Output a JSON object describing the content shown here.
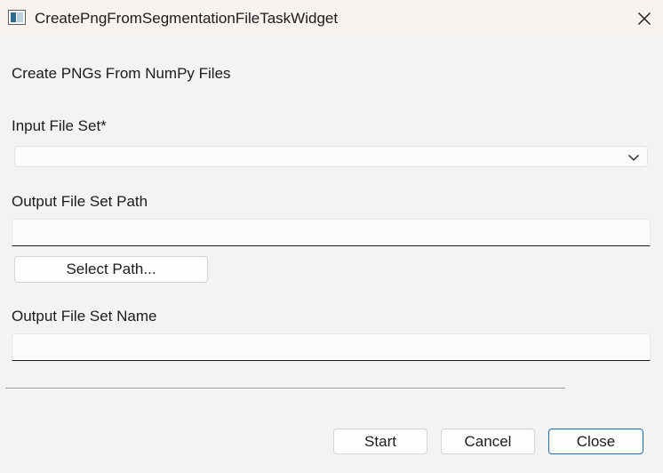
{
  "window": {
    "title": "CreatePngFromSegmentationFileTaskWidget",
    "icon": "app-window-icon",
    "close_icon": "close-icon"
  },
  "form": {
    "heading": "Create PNGs From NumPy Files",
    "input_file_set": {
      "label": "Input File Set*",
      "selected_value": "",
      "dropdown_icon": "chevron-down-icon"
    },
    "output_path": {
      "label": "Output File Set Path",
      "value": "",
      "select_button_label": "Select Path..."
    },
    "output_name": {
      "label": "Output File Set Name",
      "value": ""
    }
  },
  "actions": {
    "start_label": "Start",
    "cancel_label": "Cancel",
    "close_label": "Close"
  },
  "colors": {
    "titlebar_bg": "#f8f3ee",
    "window_bg": "#f3f3f3",
    "default_button_border": "#1f6cb5"
  }
}
